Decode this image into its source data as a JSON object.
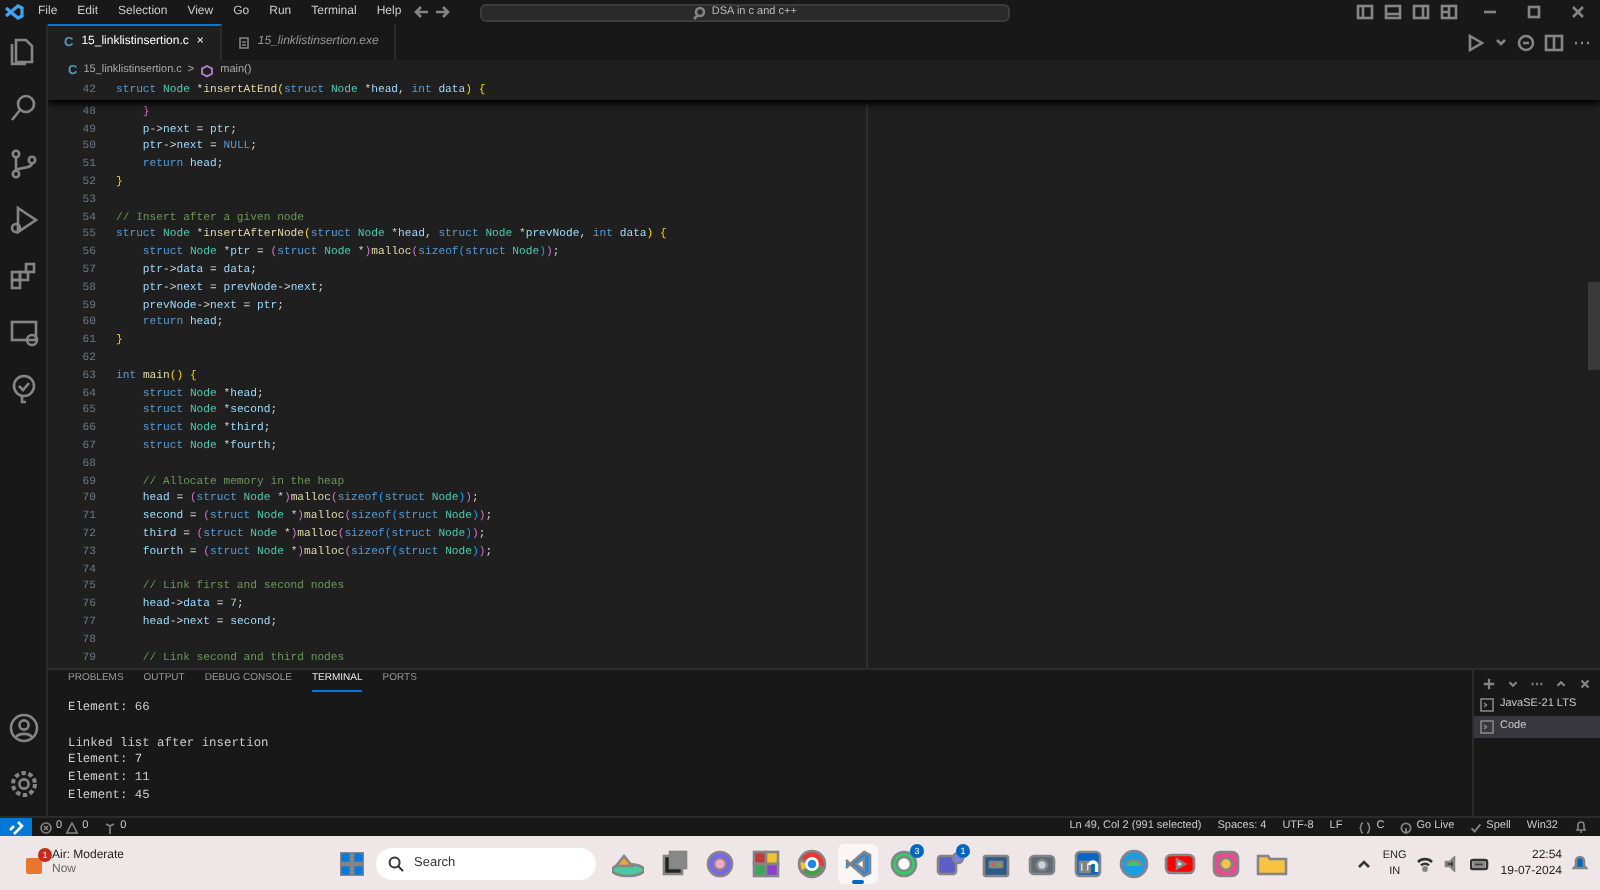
{
  "title_bar": {
    "menu": [
      "File",
      "Edit",
      "Selection",
      "View",
      "Go",
      "Run",
      "Terminal",
      "Help"
    ],
    "search": "DSA in c and c++"
  },
  "editor_tabs": [
    {
      "icon": "C",
      "label": "15_linklistinsertion.c",
      "close": "×",
      "selected": true,
      "preview": false
    },
    {
      "label": "15_linklistinsertion.exe",
      "selected": false,
      "preview": true
    }
  ],
  "breadcrumb": {
    "file_icon": "C",
    "file": "15_linklistinsertion.c",
    "separator": ">",
    "symbol": "main()"
  },
  "sticky_line": {
    "n": "42",
    "code": [
      {
        "text": "struct ",
        "kind": "keyword"
      },
      {
        "text": "Node ",
        "kind": "type"
      },
      {
        "text": "*",
        "kind": "punct"
      },
      {
        "text": "insertAtEnd",
        "kind": "function"
      },
      {
        "text": "(",
        "kind": "brace"
      },
      {
        "text": "struct ",
        "kind": "keyword"
      },
      {
        "text": "Node ",
        "kind": "type"
      },
      {
        "text": "*",
        "kind": "punct"
      },
      {
        "text": "head",
        "kind": "variable"
      },
      {
        "text": ", ",
        "kind": "punct"
      },
      {
        "text": "int ",
        "kind": "keyword"
      },
      {
        "text": "data",
        "kind": "variable"
      },
      {
        "text": ") {",
        "kind": "brace"
      }
    ]
  },
  "lines": [
    {
      "n": "48",
      "code": [
        {
          "text": "    }",
          "kind": "paren"
        }
      ]
    },
    {
      "n": "49",
      "code": [
        {
          "text": "    p",
          "kind": "variable"
        },
        {
          "text": "->",
          "kind": "punct"
        },
        {
          "text": "next",
          "kind": "variable"
        },
        {
          "text": " = ",
          "kind": "punct"
        },
        {
          "text": "ptr",
          "kind": "variable"
        },
        {
          "text": ";",
          "kind": "punct"
        }
      ]
    },
    {
      "n": "50",
      "code": [
        {
          "text": "    ptr",
          "kind": "variable"
        },
        {
          "text": "->",
          "kind": "punct"
        },
        {
          "text": "next",
          "kind": "variable"
        },
        {
          "text": " = ",
          "kind": "punct"
        },
        {
          "text": "NULL",
          "kind": "keyword"
        },
        {
          "text": ";",
          "kind": "punct"
        }
      ]
    },
    {
      "n": "51",
      "code": [
        {
          "text": "    return ",
          "kind": "keyword"
        },
        {
          "text": "head",
          "kind": "variable"
        },
        {
          "text": ";",
          "kind": "punct"
        }
      ]
    },
    {
      "n": "52",
      "code": [
        {
          "text": "}",
          "kind": "brace"
        }
      ]
    },
    {
      "n": "53"
    },
    {
      "n": "54",
      "code": [
        {
          "text": "// Insert after a given node",
          "kind": "comment"
        }
      ]
    },
    {
      "n": "55",
      "code": [
        {
          "text": "struct ",
          "kind": "keyword"
        },
        {
          "text": "Node ",
          "kind": "type"
        },
        {
          "text": "*",
          "kind": "punct"
        },
        {
          "text": "insertAfterNode",
          "kind": "function"
        },
        {
          "text": "(",
          "kind": "brace"
        },
        {
          "text": "struct ",
          "kind": "keyword"
        },
        {
          "text": "Node ",
          "kind": "type"
        },
        {
          "text": "*",
          "kind": "punct"
        },
        {
          "text": "head",
          "kind": "variable"
        },
        {
          "text": ", ",
          "kind": "punct"
        },
        {
          "text": "struct ",
          "kind": "keyword"
        },
        {
          "text": "Node ",
          "kind": "type"
        },
        {
          "text": "*",
          "kind": "punct"
        },
        {
          "text": "prevNode",
          "kind": "variable"
        },
        {
          "text": ", ",
          "kind": "punct"
        },
        {
          "text": "int ",
          "kind": "keyword"
        },
        {
          "text": "data",
          "kind": "variable"
        },
        {
          "text": ") {",
          "kind": "brace"
        }
      ]
    },
    {
      "n": "56",
      "code": [
        {
          "text": "    struct ",
          "kind": "keyword"
        },
        {
          "text": "Node ",
          "kind": "type"
        },
        {
          "text": "*",
          "kind": "punct"
        },
        {
          "text": "ptr",
          "kind": "variable"
        },
        {
          "text": " = ",
          "kind": "punct"
        },
        {
          "text": "(",
          "kind": "paren"
        },
        {
          "text": "struct ",
          "kind": "keyword"
        },
        {
          "text": "Node ",
          "kind": "type"
        },
        {
          "text": "*",
          "kind": "punct"
        },
        {
          "text": ")",
          "kind": "paren"
        },
        {
          "text": "malloc",
          "kind": "function"
        },
        {
          "text": "(",
          "kind": "paren"
        },
        {
          "text": "sizeof",
          "kind": "keyword"
        },
        {
          "text": "(",
          "kind": "inner"
        },
        {
          "text": "struct ",
          "kind": "keyword"
        },
        {
          "text": "Node",
          "kind": "type"
        },
        {
          "text": ")",
          "kind": "inner"
        },
        {
          "text": ")",
          "kind": "paren"
        },
        {
          "text": ";",
          "kind": "punct"
        }
      ]
    },
    {
      "n": "57",
      "code": [
        {
          "text": "    ptr",
          "kind": "variable"
        },
        {
          "text": "->",
          "kind": "punct"
        },
        {
          "text": "data",
          "kind": "variable"
        },
        {
          "text": " = ",
          "kind": "punct"
        },
        {
          "text": "data",
          "kind": "variable"
        },
        {
          "text": ";",
          "kind": "punct"
        }
      ]
    },
    {
      "n": "58",
      "code": [
        {
          "text": "    ptr",
          "kind": "variable"
        },
        {
          "text": "->",
          "kind": "punct"
        },
        {
          "text": "next",
          "kind": "variable"
        },
        {
          "text": " = ",
          "kind": "punct"
        },
        {
          "text": "prevNode",
          "kind": "variable"
        },
        {
          "text": "->",
          "kind": "punct"
        },
        {
          "text": "next",
          "kind": "variable"
        },
        {
          "text": ";",
          "kind": "punct"
        }
      ]
    },
    {
      "n": "59",
      "code": [
        {
          "text": "    prevNode",
          "kind": "variable"
        },
        {
          "text": "->",
          "kind": "punct"
        },
        {
          "text": "next",
          "kind": "variable"
        },
        {
          "text": " = ",
          "kind": "punct"
        },
        {
          "text": "ptr",
          "kind": "variable"
        },
        {
          "text": ";",
          "kind": "punct"
        }
      ]
    },
    {
      "n": "60",
      "code": [
        {
          "text": "    return ",
          "kind": "keyword"
        },
        {
          "text": "head",
          "kind": "variable"
        },
        {
          "text": ";",
          "kind": "punct"
        }
      ]
    },
    {
      "n": "61",
      "code": [
        {
          "text": "}",
          "kind": "brace"
        }
      ]
    },
    {
      "n": "62"
    },
    {
      "n": "63",
      "code": [
        {
          "text": "int ",
          "kind": "keyword"
        },
        {
          "text": "main",
          "kind": "function"
        },
        {
          "text": "() {",
          "kind": "brace"
        }
      ]
    },
    {
      "n": "64",
      "code": [
        {
          "text": "    struct ",
          "kind": "keyword"
        },
        {
          "text": "Node ",
          "kind": "type"
        },
        {
          "text": "*",
          "kind": "punct"
        },
        {
          "text": "head",
          "kind": "variable"
        },
        {
          "text": ";",
          "kind": "punct"
        }
      ]
    },
    {
      "n": "65",
      "code": [
        {
          "text": "    struct ",
          "kind": "keyword"
        },
        {
          "text": "Node ",
          "kind": "type"
        },
        {
          "text": "*",
          "kind": "punct"
        },
        {
          "text": "second",
          "kind": "variable"
        },
        {
          "text": ";",
          "kind": "punct"
        }
      ]
    },
    {
      "n": "66",
      "code": [
        {
          "text": "    struct ",
          "kind": "keyword"
        },
        {
          "text": "Node ",
          "kind": "type"
        },
        {
          "text": "*",
          "kind": "punct"
        },
        {
          "text": "third",
          "kind": "variable"
        },
        {
          "text": ";",
          "kind": "punct"
        }
      ]
    },
    {
      "n": "67",
      "code": [
        {
          "text": "    struct ",
          "kind": "keyword"
        },
        {
          "text": "Node ",
          "kind": "type"
        },
        {
          "text": "*",
          "kind": "punct"
        },
        {
          "text": "fourth",
          "kind": "variable"
        },
        {
          "text": ";",
          "kind": "punct"
        }
      ]
    },
    {
      "n": "68"
    },
    {
      "n": "69",
      "code": [
        {
          "text": "    // Allocate memory in the heap",
          "kind": "comment"
        }
      ]
    },
    {
      "n": "70",
      "code": [
        {
          "text": "    head",
          "kind": "variable"
        },
        {
          "text": " = ",
          "kind": "punct"
        },
        {
          "text": "(",
          "kind": "paren"
        },
        {
          "text": "struct ",
          "kind": "keyword"
        },
        {
          "text": "Node ",
          "kind": "type"
        },
        {
          "text": "*",
          "kind": "punct"
        },
        {
          "text": ")",
          "kind": "paren"
        },
        {
          "text": "malloc",
          "kind": "function"
        },
        {
          "text": "(",
          "kind": "paren"
        },
        {
          "text": "sizeof",
          "kind": "keyword"
        },
        {
          "text": "(",
          "kind": "inner"
        },
        {
          "text": "struct ",
          "kind": "keyword"
        },
        {
          "text": "Node",
          "kind": "type"
        },
        {
          "text": ")",
          "kind": "inner"
        },
        {
          "text": ")",
          "kind": "paren"
        },
        {
          "text": ";",
          "kind": "punct"
        }
      ]
    },
    {
      "n": "71",
      "code": [
        {
          "text": "    second",
          "kind": "variable"
        },
        {
          "text": " = ",
          "kind": "punct"
        },
        {
          "text": "(",
          "kind": "paren"
        },
        {
          "text": "struct ",
          "kind": "keyword"
        },
        {
          "text": "Node ",
          "kind": "type"
        },
        {
          "text": "*",
          "kind": "punct"
        },
        {
          "text": ")",
          "kind": "paren"
        },
        {
          "text": "malloc",
          "kind": "function"
        },
        {
          "text": "(",
          "kind": "paren"
        },
        {
          "text": "sizeof",
          "kind": "keyword"
        },
        {
          "text": "(",
          "kind": "inner"
        },
        {
          "text": "struct ",
          "kind": "keyword"
        },
        {
          "text": "Node",
          "kind": "type"
        },
        {
          "text": ")",
          "kind": "inner"
        },
        {
          "text": ")",
          "kind": "paren"
        },
        {
          "text": ";",
          "kind": "punct"
        }
      ]
    },
    {
      "n": "72",
      "code": [
        {
          "text": "    third",
          "kind": "variable"
        },
        {
          "text": " = ",
          "kind": "punct"
        },
        {
          "text": "(",
          "kind": "paren"
        },
        {
          "text": "struct ",
          "kind": "keyword"
        },
        {
          "text": "Node ",
          "kind": "type"
        },
        {
          "text": "*",
          "kind": "punct"
        },
        {
          "text": ")",
          "kind": "paren"
        },
        {
          "text": "malloc",
          "kind": "function"
        },
        {
          "text": "(",
          "kind": "paren"
        },
        {
          "text": "sizeof",
          "kind": "keyword"
        },
        {
          "text": "(",
          "kind": "inner"
        },
        {
          "text": "struct ",
          "kind": "keyword"
        },
        {
          "text": "Node",
          "kind": "type"
        },
        {
          "text": ")",
          "kind": "inner"
        },
        {
          "text": ")",
          "kind": "paren"
        },
        {
          "text": ";",
          "kind": "punct"
        }
      ]
    },
    {
      "n": "73",
      "code": [
        {
          "text": "    fourth",
          "kind": "variable"
        },
        {
          "text": " = ",
          "kind": "punct"
        },
        {
          "text": "(",
          "kind": "paren"
        },
        {
          "text": "struct ",
          "kind": "keyword"
        },
        {
          "text": "Node ",
          "kind": "type"
        },
        {
          "text": "*",
          "kind": "punct"
        },
        {
          "text": ")",
          "kind": "paren"
        },
        {
          "text": "malloc",
          "kind": "function"
        },
        {
          "text": "(",
          "kind": "paren"
        },
        {
          "text": "sizeof",
          "kind": "keyword"
        },
        {
          "text": "(",
          "kind": "inner"
        },
        {
          "text": "struct ",
          "kind": "keyword"
        },
        {
          "text": "Node",
          "kind": "type"
        },
        {
          "text": ")",
          "kind": "inner"
        },
        {
          "text": ")",
          "kind": "paren"
        },
        {
          "text": ";",
          "kind": "punct"
        }
      ]
    },
    {
      "n": "74"
    },
    {
      "n": "75",
      "code": [
        {
          "text": "    // Link first and second nodes",
          "kind": "comment"
        }
      ]
    },
    {
      "n": "76",
      "code": [
        {
          "text": "    head",
          "kind": "variable"
        },
        {
          "text": "->",
          "kind": "punct"
        },
        {
          "text": "data",
          "kind": "variable"
        },
        {
          "text": " = ",
          "kind": "punct"
        },
        {
          "text": "7",
          "kind": "number"
        },
        {
          "text": ";",
          "kind": "punct"
        }
      ]
    },
    {
      "n": "77",
      "code": [
        {
          "text": "    head",
          "kind": "variable"
        },
        {
          "text": "->",
          "kind": "punct"
        },
        {
          "text": "next",
          "kind": "variable"
        },
        {
          "text": " = ",
          "kind": "punct"
        },
        {
          "text": "second",
          "kind": "variable"
        },
        {
          "text": ";",
          "kind": "punct"
        }
      ]
    },
    {
      "n": "78"
    },
    {
      "n": "79",
      "code": [
        {
          "text": "    // Link second and third nodes",
          "kind": "comment"
        }
      ]
    }
  ],
  "panel": {
    "tabs": [
      {
        "label": "PROBLEMS",
        "selected": false
      },
      {
        "label": "OUTPUT",
        "selected": false
      },
      {
        "label": "DEBUG CONSOLE",
        "selected": false
      },
      {
        "label": "TERMINAL",
        "selected": true
      },
      {
        "label": "PORTS",
        "selected": false
      }
    ],
    "terminal_lines": [
      {
        "text": "Element: 66",
        "gap_before": false
      },
      {
        "text": "Linked list after insertion",
        "gap_before": true
      },
      {
        "text": "Element: 7",
        "gap_before": false
      },
      {
        "text": "Element: 11",
        "gap_before": false
      },
      {
        "text": "Element: 45",
        "gap_before": false
      }
    ],
    "terminals": [
      {
        "label": "JavaSE-21 LTS",
        "selected": false
      },
      {
        "label": "Code",
        "selected": true
      }
    ]
  },
  "status_bar": {
    "errors": "0",
    "warnings": "0",
    "ports": "0",
    "items": [
      {
        "kind": "text",
        "label": "Ln 49, Col 2 (991 selected)"
      },
      {
        "kind": "text",
        "label": "Spaces: 4"
      },
      {
        "kind": "text",
        "label": "UTF-8"
      },
      {
        "kind": "text",
        "label": "LF"
      },
      {
        "kind": "braces",
        "label": "C"
      },
      {
        "kind": "live",
        "label": "Go Live"
      },
      {
        "kind": "check",
        "label": "Spell"
      },
      {
        "kind": "text",
        "label": "Win32"
      },
      {
        "kind": "bell"
      }
    ]
  },
  "taskbar": {
    "weather": {
      "title": "Air: Moderate",
      "subtitle": "Now",
      "badge": "1"
    },
    "search": "Search",
    "apps": [
      {
        "kind": "widget",
        "selected": false
      },
      {
        "kind": "taskview",
        "selected": false
      },
      {
        "kind": "copilot",
        "selected": false
      },
      {
        "kind": "tiles",
        "selected": false
      },
      {
        "kind": "browser",
        "selected": false
      },
      {
        "kind": "code",
        "selected": true
      },
      {
        "kind": "chat",
        "badge": "3",
        "selected": false
      },
      {
        "kind": "team",
        "badge": "1",
        "selected": false
      },
      {
        "kind": "store",
        "selected": false
      },
      {
        "kind": "camera",
        "selected": false
      },
      {
        "kind": "linkedin",
        "selected": false
      },
      {
        "kind": "edge",
        "selected": false
      },
      {
        "kind": "video",
        "selected": false
      },
      {
        "kind": "photos",
        "selected": false
      },
      {
        "kind": "folder",
        "selected": false
      }
    ],
    "lang": "ENG",
    "region": "IN",
    "time": "22:54",
    "date": "19-07-2024"
  }
}
